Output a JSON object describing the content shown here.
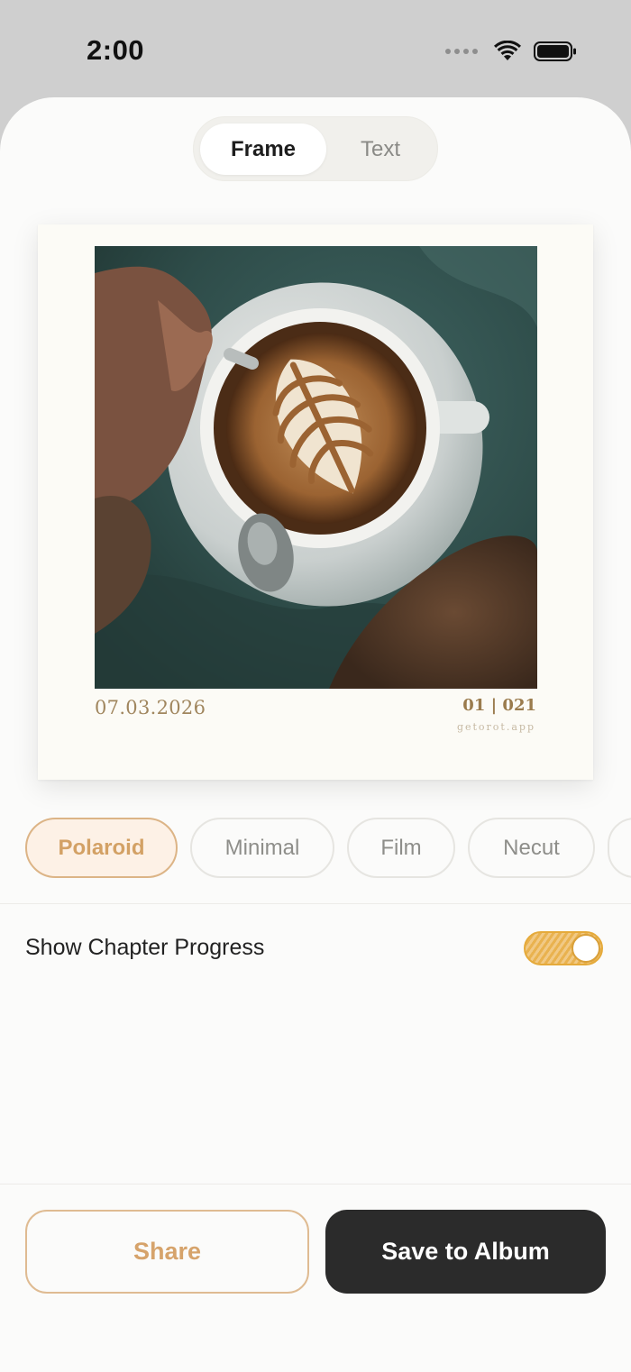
{
  "status_bar": {
    "time": "2:00",
    "icons": [
      "cellular-dots-icon",
      "wifi-icon",
      "battery-icon"
    ]
  },
  "tabs": [
    {
      "label": "Frame",
      "selected": true
    },
    {
      "label": "Text",
      "selected": false
    }
  ],
  "preview": {
    "photo": "latte-art-coffee-cup-photo",
    "date": "07.03.2026",
    "count": "01 | 021",
    "watermark": "getorot.app"
  },
  "frame_styles": [
    {
      "label": "Polaroid",
      "selected": true
    },
    {
      "label": "Minimal",
      "selected": false
    },
    {
      "label": "Film",
      "selected": false
    },
    {
      "label": "Necut",
      "selected": false
    }
  ],
  "settings": {
    "chapter_progress_label": "Show Chapter Progress",
    "chapter_progress_on": true
  },
  "actions": {
    "share_label": "Share",
    "save_label": "Save to Album"
  },
  "colors": {
    "accent": "#D6A36B",
    "toggle": "#E9B24F",
    "primary_button": "#2B2B2B"
  }
}
